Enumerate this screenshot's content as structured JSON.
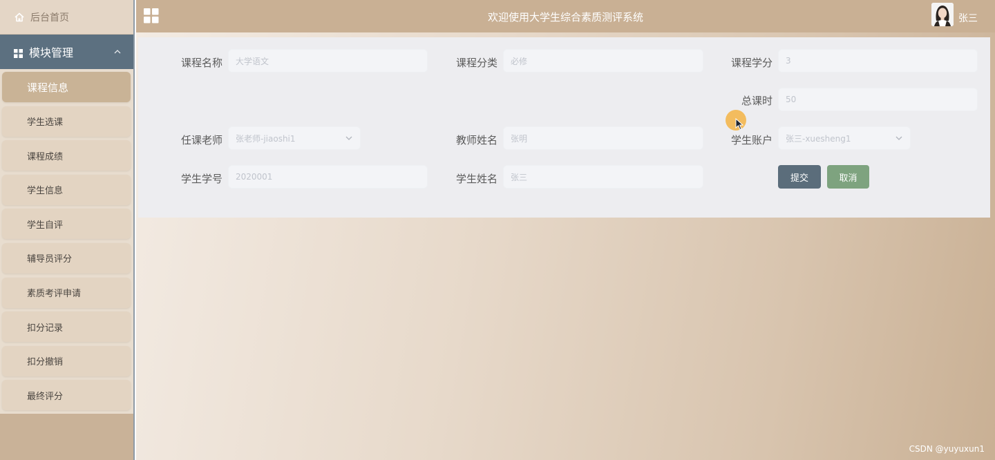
{
  "sidebar": {
    "home": {
      "label": "后台首页",
      "icon": "home-icon"
    },
    "module": {
      "label": "模块管理",
      "icon": "grid-icon",
      "expanded": true
    },
    "items": [
      {
        "label": "课程信息",
        "active": true
      },
      {
        "label": "学生选课",
        "active": false
      },
      {
        "label": "课程成绩",
        "active": false
      },
      {
        "label": "学生信息",
        "active": false
      },
      {
        "label": "学生自评",
        "active": false
      },
      {
        "label": "辅导员评分",
        "active": false
      },
      {
        "label": "素质考评申请",
        "active": false
      },
      {
        "label": "扣分记录",
        "active": false
      },
      {
        "label": "扣分撤销",
        "active": false
      },
      {
        "label": "最终评分",
        "active": false
      }
    ]
  },
  "header": {
    "title": "欢迎使用大学生综合素质测评系统",
    "username": "张三",
    "menu_icon": "grid-icon"
  },
  "form": {
    "course_name": {
      "label": "课程名称",
      "value": "大学语文"
    },
    "course_category": {
      "label": "课程分类",
      "value": "必修"
    },
    "course_credit": {
      "label": "课程学分",
      "value": "3"
    },
    "total_hours": {
      "label": "总课时",
      "value": "50"
    },
    "teacher_account": {
      "label": "任课老师",
      "value": "张老师-jiaoshi1"
    },
    "teacher_name": {
      "label": "教师姓名",
      "value": "张明"
    },
    "student_account": {
      "label": "学生账户",
      "value": "张三-xuesheng1"
    },
    "student_id": {
      "label": "学生学号",
      "value": "2020001"
    },
    "student_name": {
      "label": "学生姓名",
      "value": "张三"
    },
    "submit_label": "提交",
    "cancel_label": "取消"
  },
  "watermark": "CSDN @yuyuxun1",
  "colors": {
    "sidebar_bg": "#c9b298",
    "module_header": "#5c7080",
    "active_item": "#c9b396",
    "header_bg": "#c9b094",
    "submit_button": "#5b6d7b",
    "cancel_button": "#7ea37f"
  }
}
